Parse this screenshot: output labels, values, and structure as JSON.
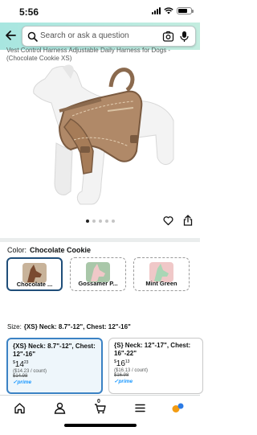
{
  "status_bar": {
    "time": "5:56"
  },
  "search": {
    "placeholder": "Search or ask a question"
  },
  "product": {
    "title_cut": "Vest Control Harness Adjustable Daily Harness for Dogs - (Chocolate Cookie XS)",
    "image_desc": "tan dog harness on white dog mannequin",
    "carousel": {
      "total": 5,
      "active": 0
    }
  },
  "color": {
    "label": "Color:",
    "selected": "Chocolate Cookie",
    "options": [
      {
        "label": "Chocolate ...",
        "bg": "#c8b39a",
        "dog": "#7a4a30",
        "selected": true
      },
      {
        "label": "Gossamer P...",
        "bg": "#a9c7a9",
        "dog": "#f0c8c8",
        "selected": false
      },
      {
        "label": "Mint Green",
        "bg": "#f0c8c8",
        "dog": "#a9d6b5",
        "selected": false
      }
    ]
  },
  "size": {
    "label": "Size:",
    "selected": "{XS} Neck: 8.7\"-12\", Chest: 12\"-16\"",
    "options": [
      {
        "title": "{XS} Neck: 8.7\"-12\", Chest: 12\"-16\"",
        "price_whole": "14",
        "price_frac": "23",
        "unit": "($14.23 / count)",
        "list_price": "$14.98",
        "prime": "prime"
      },
      {
        "title": "{S} Neck: 12\"-17\", Chest: 16\"-22\"",
        "price_whole": "16",
        "price_frac": "13",
        "unit": "($16.13 / count)",
        "list_price": "$16.98",
        "prime": "prime"
      }
    ]
  },
  "nav": {
    "cart_count": "0"
  },
  "colors": {
    "accent_blue": "#3b82c4",
    "prime_blue": "#1a98ff",
    "header_teal": "#a8e6e0"
  }
}
